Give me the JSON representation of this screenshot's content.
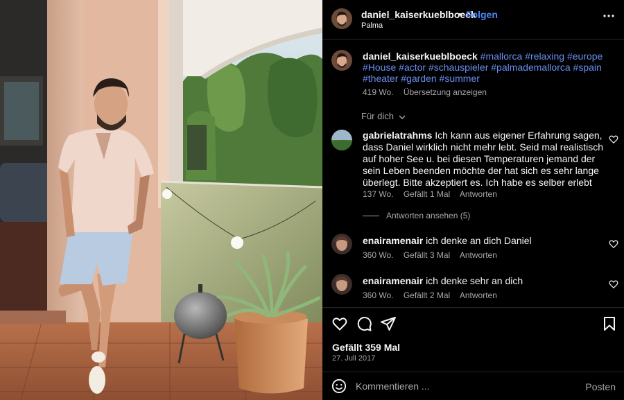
{
  "post": {
    "username": "daniel_kaiserkueblboeck",
    "separator": "•",
    "follow_label": "Folgen",
    "location": "Palma",
    "more_icon": "more-horizontal-icon"
  },
  "caption": {
    "username": "daniel_kaiserkueblboeck",
    "hashtags": [
      "#mallorca",
      "#relaxing",
      "#europe",
      "#House",
      "#actor",
      "#schauspieler",
      "#palmademallorca",
      "#spain",
      "#theater",
      "#garden",
      "#summer"
    ],
    "age": "419 Wo.",
    "translate_label": "Übersetzung anzeigen"
  },
  "for_you": {
    "label": "Für dich",
    "icon": "chevron-down-icon"
  },
  "comments": [
    {
      "username": "gabrielatrahms",
      "text": "Ich kann aus eigener Erfahrung sagen, dass Daniel wirklich nicht mehr lebt. Seid mal realistisch auf hoher See u. bei diesen Temperaturen jemand der sein Leben beenden möchte der hat sich es sehr lange überlegt. Bitte akzeptiert es. Ich habe es selber erlebt",
      "age": "137 Wo.",
      "likes": "Gefällt 1 Mal",
      "reply": "Antworten",
      "view_replies": "Antworten ansehen (5)"
    },
    {
      "username": "enairamenair",
      "text": "ich denke an dich Daniel",
      "age": "360 Wo.",
      "likes": "Gefällt 3 Mal",
      "reply": "Antworten"
    },
    {
      "username": "enairamenair",
      "text": "ich denke sehr an dich",
      "age": "360 Wo.",
      "likes": "Gefällt 2 Mal",
      "reply": "Antworten"
    }
  ],
  "stats": {
    "likes": "Gefällt 359 Mal",
    "date": "27. Juli 2017"
  },
  "composer": {
    "placeholder": "Kommentieren ...",
    "post_label": "Posten",
    "emoji_icon": "emoji-icon"
  },
  "colors": {
    "background": "#000000",
    "link": "#4f86f7",
    "muted": "#a8a8a8",
    "text": "#f5f5f5"
  }
}
